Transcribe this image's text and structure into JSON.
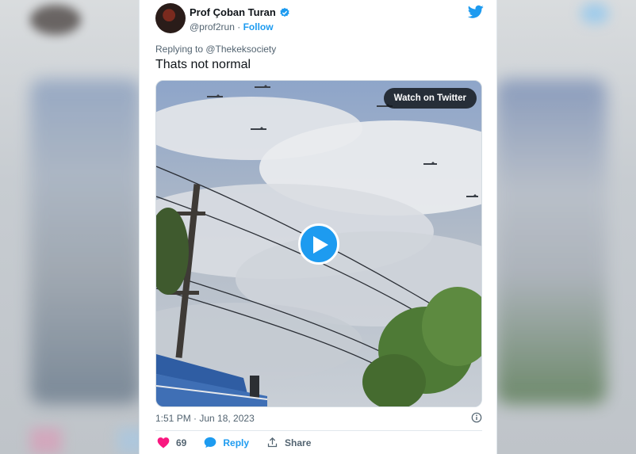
{
  "author": {
    "name": "Prof Çoban Turan",
    "handle": "@prof2run",
    "separator": "·",
    "follow_label": "Follow"
  },
  "replying_to": "Replying to @Thekeksociety",
  "text": "Thats not normal",
  "media": {
    "watch_label": "Watch on Twitter",
    "icon": "play-icon"
  },
  "timestamp": "1:51 PM · Jun 18, 2023",
  "actions": {
    "likes": "69",
    "reply_label": "Reply",
    "share_label": "Share"
  },
  "colors": {
    "accent": "#1d9bf0",
    "like": "#f91880",
    "muted": "#536471",
    "text": "#0f1419"
  }
}
